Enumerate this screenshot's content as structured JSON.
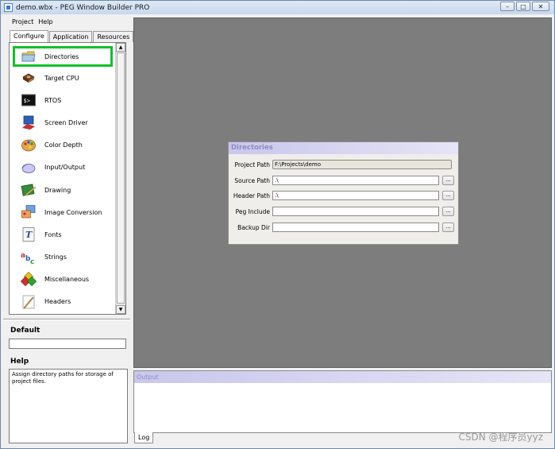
{
  "window": {
    "title": "demo.wbx - PEG Window Builder PRO",
    "controls": [
      "–",
      "□",
      "✕"
    ]
  },
  "menu": {
    "items": [
      "Project",
      "Help"
    ]
  },
  "tabs": [
    "Configure",
    "Application",
    "Resources"
  ],
  "nav": {
    "items": [
      {
        "label": "Directories",
        "icon": "folder-icon"
      },
      {
        "label": "Target CPU",
        "icon": "chip-icon"
      },
      {
        "label": "RTOS",
        "icon": "terminal-icon"
      },
      {
        "label": "Screen Driver",
        "icon": "monitor-icon"
      },
      {
        "label": "Color Depth",
        "icon": "palette-icon"
      },
      {
        "label": "Input/Output",
        "icon": "mouse-icon"
      },
      {
        "label": "Drawing",
        "icon": "drawing-icon"
      },
      {
        "label": "Image Conversion",
        "icon": "image-icon"
      },
      {
        "label": "Fonts",
        "icon": "font-icon"
      },
      {
        "label": "Strings",
        "icon": "abc-icon"
      },
      {
        "label": "Miscellaneous",
        "icon": "blocks-icon"
      },
      {
        "label": "Headers",
        "icon": "pen-icon"
      }
    ]
  },
  "default": {
    "label": "Default",
    "value": ""
  },
  "help": {
    "label": "Help",
    "text": "Assign directory paths for storage of project files."
  },
  "dialog": {
    "title": "Directories",
    "rows": [
      {
        "label": "Project Path",
        "value": "F:\\Projects\\demo",
        "browse": ""
      },
      {
        "label": "Source Path",
        "value": ".\\",
        "browse": "..."
      },
      {
        "label": "Header Path",
        "value": ".\\",
        "browse": "..."
      },
      {
        "label": "Peg Include",
        "value": "",
        "browse": "..."
      },
      {
        "label": "Backup Dir",
        "value": "",
        "browse": "..."
      }
    ]
  },
  "output": {
    "title": "Output",
    "tab": "Log"
  },
  "watermark": "CSDN @程序员yyz",
  "colors": {
    "selection": "#12c12a",
    "workspace": "#7d7d7d",
    "panel_title": "#c9c7ec"
  }
}
